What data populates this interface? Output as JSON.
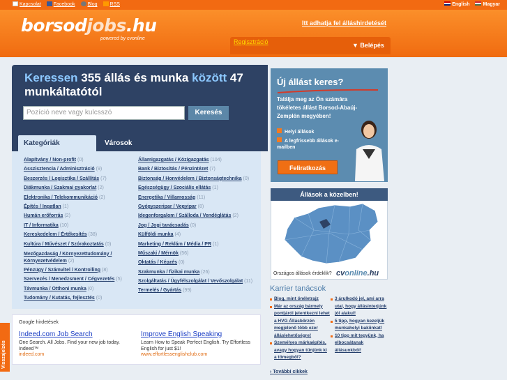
{
  "top": {
    "links": [
      "Kapcsolat",
      "Facebook",
      "Blog",
      "RSS"
    ],
    "langs": [
      "English",
      "Magyar"
    ]
  },
  "header": {
    "logo_a": "borsod",
    "logo_b": "jobs",
    "logo_c": ".hu",
    "powered": "powered by cvonline",
    "ad_link": "Itt adhatja fel álláshirdetését",
    "register": "Regisztráció",
    "login": "Belépés"
  },
  "search": {
    "h1": "Keressen",
    "count1": "355",
    "h2": "állás és munka",
    "h3": "között",
    "count2": "47",
    "h4": "munkáltatótól",
    "placeholder": "Pozíció neve vagy kulcsszó",
    "button": "Keresés"
  },
  "tabs": [
    "Kategóriák",
    "Városok"
  ],
  "categories_left": [
    {
      "name": "Alapítvány / Non-profit",
      "count": "(0)"
    },
    {
      "name": "Asszisztencia / Adminisztráció",
      "count": "(9)"
    },
    {
      "name": "Beszerzés / Logisztika / Szállítás",
      "count": "(7)"
    },
    {
      "name": "Diákmunka / Szakmai gyakorlat",
      "count": "(2)"
    },
    {
      "name": "Elektronika / Telekommunikáció",
      "count": "(2)"
    },
    {
      "name": "Építés / Ingatlan",
      "count": "(1)"
    },
    {
      "name": "Humán erőforrás",
      "count": "(2)"
    },
    {
      "name": "IT / Informatika",
      "count": "(10)"
    },
    {
      "name": "Kereskedelem / Értékesítés",
      "count": "(38)"
    },
    {
      "name": "Kultúra / Művészet / Szórakoztatás",
      "count": "(0)"
    },
    {
      "name": "Mezőgazdaság / Környezettudomány / Környezetvédelem",
      "count": "(2)"
    },
    {
      "name": "Pénzügy / Számvitel / Kontrolling",
      "count": "(8)"
    },
    {
      "name": "Szervezés / Menedzsment / Cégvezetés",
      "count": "(5)"
    },
    {
      "name": "Távmunka / Otthoni munka",
      "count": "(0)"
    },
    {
      "name": "Tudomány / Kutatás, fejlesztés",
      "count": "(0)"
    }
  ],
  "categories_right": [
    {
      "name": "Államigazgatás / Közigazgatás",
      "count": "(104)"
    },
    {
      "name": "Bank / Biztosítás / Pénzintézet",
      "count": "(7)"
    },
    {
      "name": "Biztonság / Honvédelem / Biztonságtechnika",
      "count": "(0)"
    },
    {
      "name": "Egészségügy / Szociális ellátás",
      "count": "(1)"
    },
    {
      "name": "Energetika / Villamosság",
      "count": "(11)"
    },
    {
      "name": "Gyógyszeripar / Vegyipar",
      "count": "(8)"
    },
    {
      "name": "Idegenforgalom / Szálloda / Vendéglátás",
      "count": "(2)"
    },
    {
      "name": "Jog / Jogi tanácsadás",
      "count": "(0)"
    },
    {
      "name": "Külföldi munka",
      "count": "(4)"
    },
    {
      "name": "Marketing / Reklám / Média / PR",
      "count": "(1)"
    },
    {
      "name": "Műszaki / Mérnök",
      "count": "(56)"
    },
    {
      "name": "Oktatás / Képzés",
      "count": "(0)"
    },
    {
      "name": "Szakmunka / fizikai munka",
      "count": "(26)"
    },
    {
      "name": "Szolgáltatás / Ügyfélszolgálat / Vevőszolgálat",
      "count": "(11)"
    },
    {
      "name": "Termelés / Gyártás",
      "count": "(99)"
    }
  ],
  "ads": {
    "title": "Google hirdetések",
    "items": [
      {
        "title": "Indeed.com Job Search",
        "desc": "One Search. All Jobs.  Find your new job today. Indeed™",
        "url": "indeed.com"
      },
      {
        "title": "Improve English Speaking",
        "desc": "Learn How to Speak Perfect English.  Try Effortless English for just $1!",
        "url": "www.effortlessenglishclub.com"
      }
    ]
  },
  "promo": {
    "title": "Új állást keres?",
    "text": "Találja meg az Ön számára tökéletes állást Borsod-Abaúj-Zemplén megyében!",
    "check1": "Helyi állások",
    "check2": "A legfrissebb állások e-mailben",
    "button": "Feliratkozás"
  },
  "nearby": {
    "title": "Állások a közelben!",
    "footer": "Országos állások érdeklik?",
    "logo_a": "cv",
    "logo_b": "online",
    "logo_c": ".hu"
  },
  "advice": {
    "title": "Karrier tanácsok",
    "left": [
      "Blog, mint önéletrajz",
      "Már az ország bármely pontjáról jelentkezni lehet a HVG Állásbörzén megjelenő több ezer álláslehetőségre!",
      "Személyes márkaépítés, avagy hogyan tűnjünk ki a tömegből?"
    ],
    "right": [
      "3 árulkodó jel, ami arra utal, hogy állásinterjúnk jól alakul!",
      "5 tipp, hogyan kezeljük munkahelyi bakiinkat!",
      "10 tipp mit tegyünk, ha elbocsátanak állásunkból!"
    ],
    "more": "További cikkek"
  },
  "feedback": "Visszajelzés",
  "colors": {
    "orange": "#f26a12",
    "navy": "#2e4264",
    "light_blue": "#d9e7f5"
  }
}
